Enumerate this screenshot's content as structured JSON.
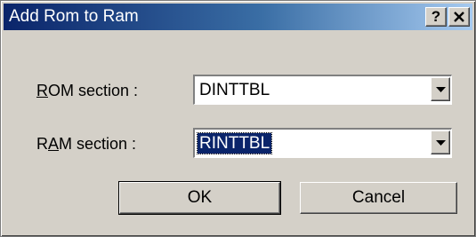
{
  "window": {
    "title": "Add Rom to Ram",
    "help_glyph": "?",
    "icons": {
      "help": "help-question-icon",
      "close": "close-x-icon",
      "dropdown": "chevron-down-icon"
    }
  },
  "form": {
    "rom": {
      "label_accel": "R",
      "label_rest": "OM section :",
      "value": "DINTTBL"
    },
    "ram": {
      "label_pre": "R",
      "label_accel": "A",
      "label_rest": "M section :",
      "value": "RINTTBL",
      "selected": true
    }
  },
  "buttons": {
    "ok": "OK",
    "cancel": "Cancel"
  },
  "colors": {
    "titlebar_start": "#0a246a",
    "titlebar_end": "#a6caf0",
    "face": "#d4d0c8",
    "selection": "#0a246a"
  }
}
